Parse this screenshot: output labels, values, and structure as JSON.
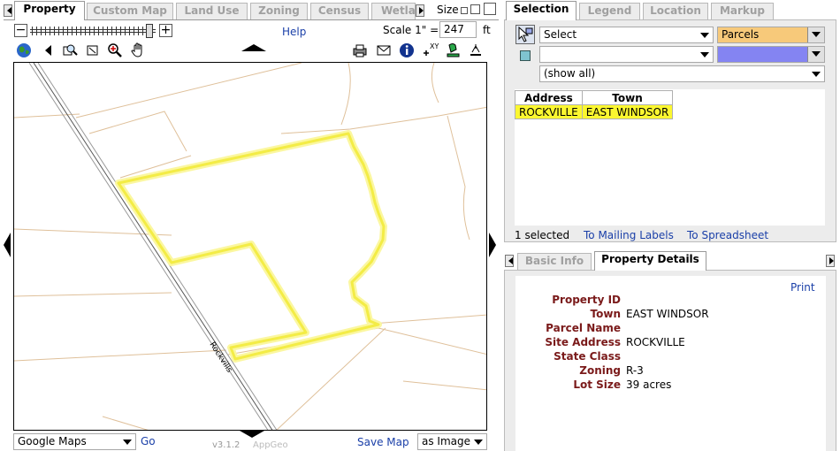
{
  "left_tabs": [
    "Property",
    "Custom Map",
    "Land Use",
    "Zoning",
    "Census",
    "Wetla"
  ],
  "size_label": "Size",
  "help": "Help",
  "scale": {
    "label": "Scale 1\" =",
    "value": "247",
    "unit": "ft"
  },
  "map": {
    "road_label": "Rockvills",
    "version": "v3.1.2",
    "brand": "AppGeo"
  },
  "bottom_bar": {
    "basemap": "Google Maps",
    "go": "Go",
    "save_map": "Save Map",
    "save_format": "as Image"
  },
  "right_tabs": [
    "Selection",
    "Legend",
    "Location",
    "Markup"
  ],
  "selection": {
    "action": "Select",
    "layer": "Parcels",
    "filter": "",
    "show": "(show all)",
    "columns": [
      "Address",
      "Town"
    ],
    "rows": [
      [
        "ROCKVILLE",
        "EAST WINDSOR"
      ]
    ],
    "count_text": "1 selected",
    "mailing_labels": "To Mailing Labels",
    "spreadsheet": "To Spreadsheet"
  },
  "detail_tabs": [
    "Basic Info",
    "Property Details"
  ],
  "details": {
    "print": "Print",
    "fields": [
      {
        "label": "Property ID",
        "value": ""
      },
      {
        "label": "Town",
        "value": "EAST WINDSOR"
      },
      {
        "label": "Parcel Name",
        "value": ""
      },
      {
        "label": "Site Address",
        "value": "ROCKVILLE"
      },
      {
        "label": "State Class",
        "value": ""
      },
      {
        "label": "Zoning",
        "value": "R-3"
      },
      {
        "label": "Lot Size",
        "value": "39 acres"
      }
    ]
  },
  "colors": {
    "highlight": "#fbf730",
    "layer_swatch": "#f7c97a",
    "fill_swatch": "#8484f2",
    "label_red": "#7a1a1a",
    "link": "#1a3fa8"
  }
}
